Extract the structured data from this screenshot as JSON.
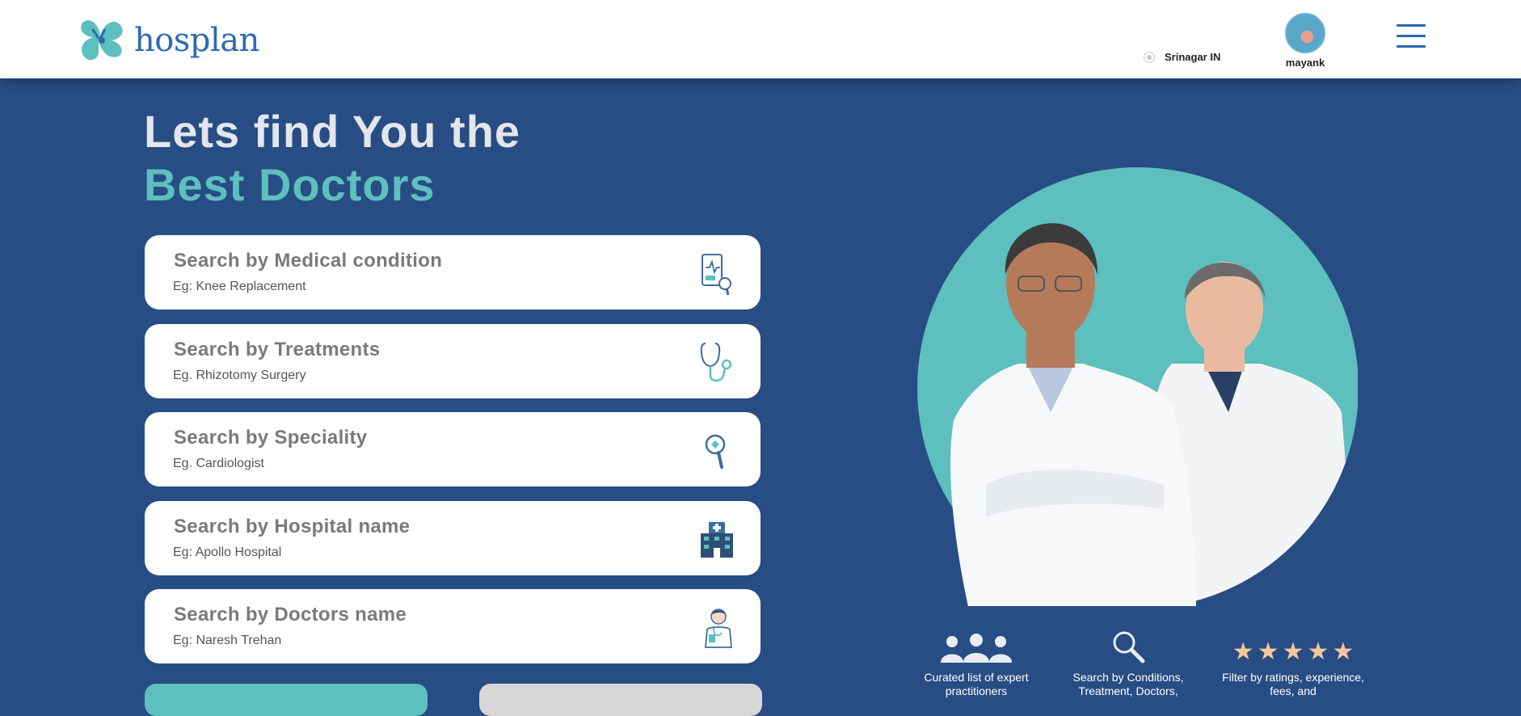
{
  "header": {
    "brand": "hosplan",
    "location": "Srinagar IN",
    "username": "mayank"
  },
  "hero": {
    "title_line1": "Lets find You the",
    "title_line2": "Best Doctors"
  },
  "search_options": [
    {
      "title": "Search by Medical condition",
      "example": "Eg: Knee Replacement",
      "icon": "medical-report-icon"
    },
    {
      "title": "Search by Treatments",
      "example": "Eg. Rhizotomy Surgery",
      "icon": "stethoscope-icon"
    },
    {
      "title": "Search by Speciality",
      "example": "Eg. Cardiologist",
      "icon": "magnifier-icon"
    },
    {
      "title": "Search by Hospital name",
      "example": "Eg: Apollo Hospital",
      "icon": "hospital-building-icon"
    },
    {
      "title": "Search by Doctors name",
      "example": "Eg: Naresh Trehan",
      "icon": "doctor-icon"
    }
  ],
  "features": [
    {
      "text": "Curated list of expert practitioners",
      "icon": "doctors-group-icon"
    },
    {
      "text": "Search by Conditions, Treatment, Doctors,",
      "icon": "search-icon"
    },
    {
      "text": "Filter by ratings, experience, fees, and",
      "icon": "five-stars-icon"
    }
  ],
  "colors": {
    "background": "#284d85",
    "accent": "#5ebfbf",
    "brand_blue": "#2c6bb3",
    "star": "#f6c79c"
  }
}
